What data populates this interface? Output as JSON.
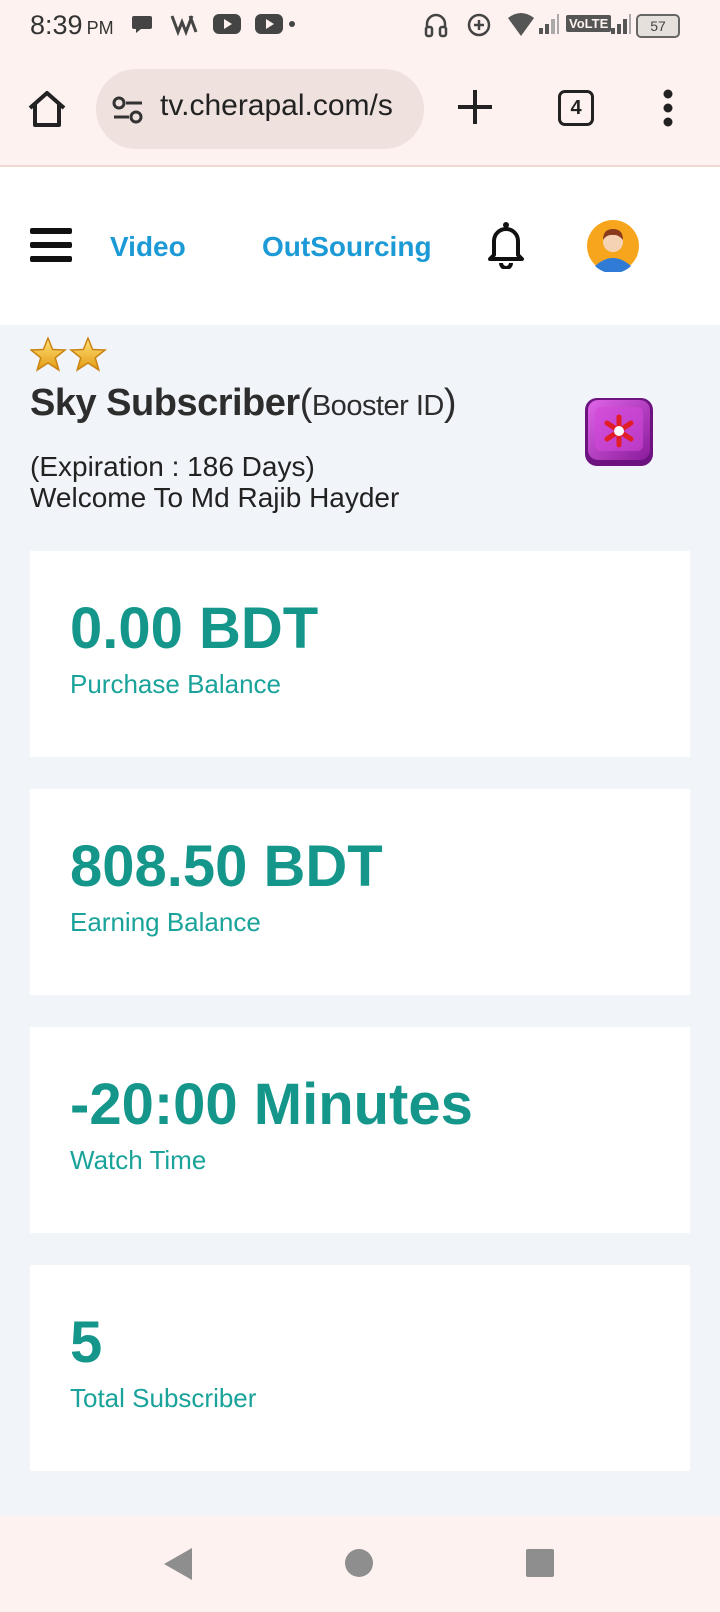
{
  "status_bar": {
    "time": "8:39",
    "ampm": "PM",
    "network": "VoLTE",
    "battery": "57"
  },
  "browser": {
    "url": "tv.cherapal.com/s",
    "tab_count": "4"
  },
  "navbar": {
    "video_label": "Video",
    "outsourcing_label": "OutSourcing"
  },
  "profile": {
    "star_count": 2,
    "title_main": "Sky Subscriber",
    "title_paren_open": "(",
    "title_booster": "Booster ID",
    "title_paren_close": ")",
    "expiration": "(Expiration : 186 Days)",
    "welcome": "Welcome To Md Rajib Hayder"
  },
  "cards": [
    {
      "value": "0.00 BDT",
      "label": "Purchase Balance"
    },
    {
      "value": "808.50 BDT",
      "label": "Earning Balance"
    },
    {
      "value": "-20:00 Minutes",
      "label": "Watch Time"
    },
    {
      "value": "5",
      "label": "Total Subscriber"
    }
  ],
  "colors": {
    "accent_teal": "#14968b",
    "nav_link_blue": "#1b9ad6",
    "page_bg": "#f1f4f9",
    "browser_chrome": "#fdf2ef"
  }
}
